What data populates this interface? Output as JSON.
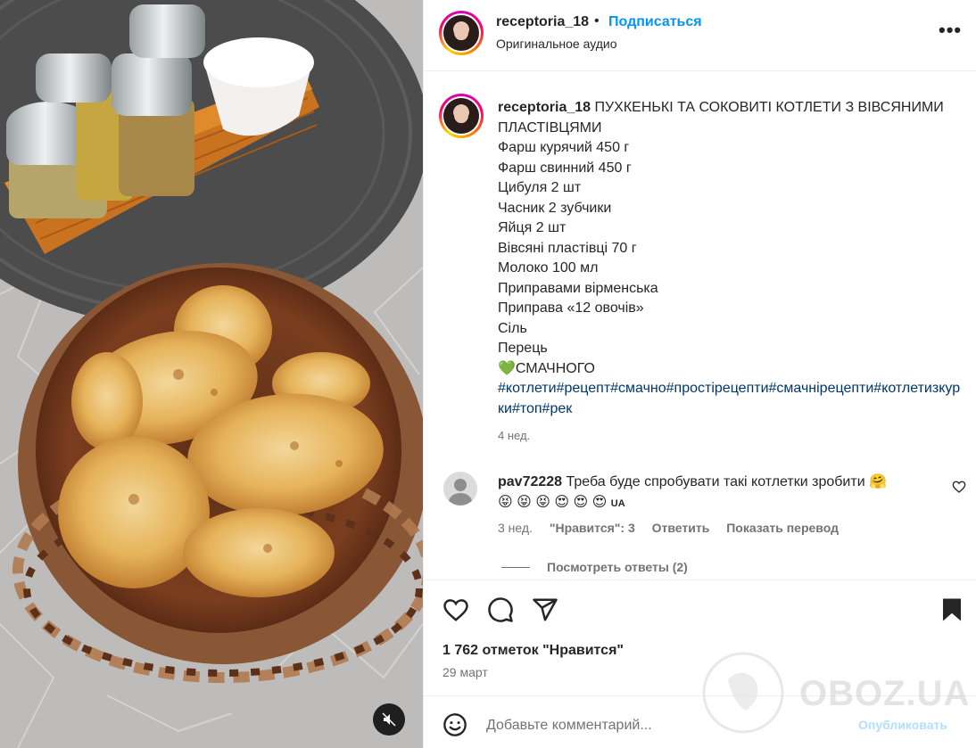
{
  "post": {
    "username": "receptoria_18",
    "dot": "•",
    "follow_label": "Подписаться",
    "audio": "Оригинальное аудио",
    "more_label": "•••"
  },
  "caption": {
    "username": "receptoria_18",
    "title": "ПУХКЕНЬКІ ТА СОКОВИТІ КОТЛЕТИ З ВІВСЯНИМИ ПЛАСТІВЦЯМИ",
    "lines": [
      "Фарш курячий 450 г",
      "Фарш свинний 450 г",
      "Цибуля 2 шт",
      "Часник 2 зубчики",
      "Яйця 2 шт",
      "Вівсяні пластівці 70 г",
      "Молоко 100 мл",
      "Приправами вірменська",
      "Приправа «12 овочів»",
      "Сіль",
      "Перець"
    ],
    "closing_emoji": "💚",
    "closing": "СМАЧНОГО",
    "hashtags": "#котлети#рецепт#смачно#простірецепти#смачнірецепти#котлетизкурки#топ#рек",
    "time": "4 нед."
  },
  "comment": {
    "username": "pav72228",
    "text": "Треба буде спробувати такі котлетки зробити 🤗",
    "emojis": "😝 😝 😝 😍 😍 😍",
    "flag": "UA",
    "time": "3 нед.",
    "likes": "\"Нравится\": 3",
    "reply_label": "Ответить",
    "translate_label": "Показать перевод",
    "view_replies": "Посмотреть ответы (2)"
  },
  "footer": {
    "likes": "1 762 отметок \"Нравится\"",
    "date": "29 март",
    "input_placeholder": "Добавьте комментарий...",
    "post_label": "Опубликовать"
  },
  "watermark": {
    "text": "OBOZ.UA"
  },
  "colors": {
    "link": "#0095f6",
    "hashtag": "#00376b",
    "muted": "#737373",
    "post_disabled": "#b2dffc"
  },
  "icons": [
    "mute-icon",
    "more-icon",
    "heart-icon",
    "comment-icon",
    "share-icon",
    "bookmark-icon",
    "emoji-icon",
    "green-heart-icon"
  ]
}
